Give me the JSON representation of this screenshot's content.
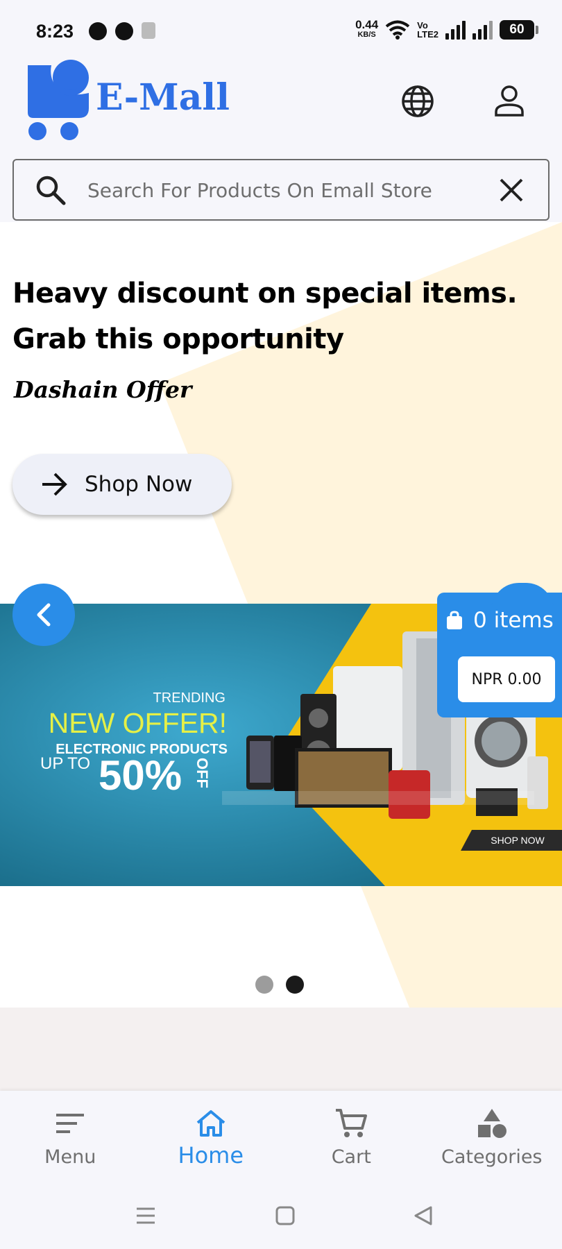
{
  "status_bar": {
    "time": "8:23",
    "net_speed": "0.44",
    "net_speed_unit": "KB/S",
    "volte_top": "Vo",
    "volte_bottom": "LTE2",
    "battery": "60"
  },
  "header": {
    "brand": "E-Mall",
    "icons": [
      "globe-icon",
      "user-icon"
    ]
  },
  "search": {
    "placeholder": "Search For Products On Emall Store",
    "value": ""
  },
  "hero": {
    "headline": "Heavy discount on special items. Grab this opportunity",
    "subtitle": "Dashain Offer",
    "cta_label": "Shop Now"
  },
  "banner": {
    "trending": "TRENDING",
    "offer": "NEW OFFER!",
    "category": "ELECTRONIC PRODUCTS",
    "upto": "UP TO",
    "percent": "50%",
    "off": "OFF",
    "shop_now": "SHOP NOW"
  },
  "cart_widget": {
    "items_label": "0 items",
    "price": "NPR 0.00"
  },
  "carousel": {
    "slide_count": 2,
    "active_index": 1
  },
  "bottom_nav": {
    "items": [
      {
        "label": "Menu",
        "icon": "menu-icon"
      },
      {
        "label": "Home",
        "icon": "home-icon",
        "active": true
      },
      {
        "label": "Cart",
        "icon": "cart-icon"
      },
      {
        "label": "Categories",
        "icon": "categories-icon"
      }
    ]
  },
  "colors": {
    "accent": "#2a8de8",
    "brand": "#2f6fe4",
    "hero_shape": "#fff4dc"
  }
}
